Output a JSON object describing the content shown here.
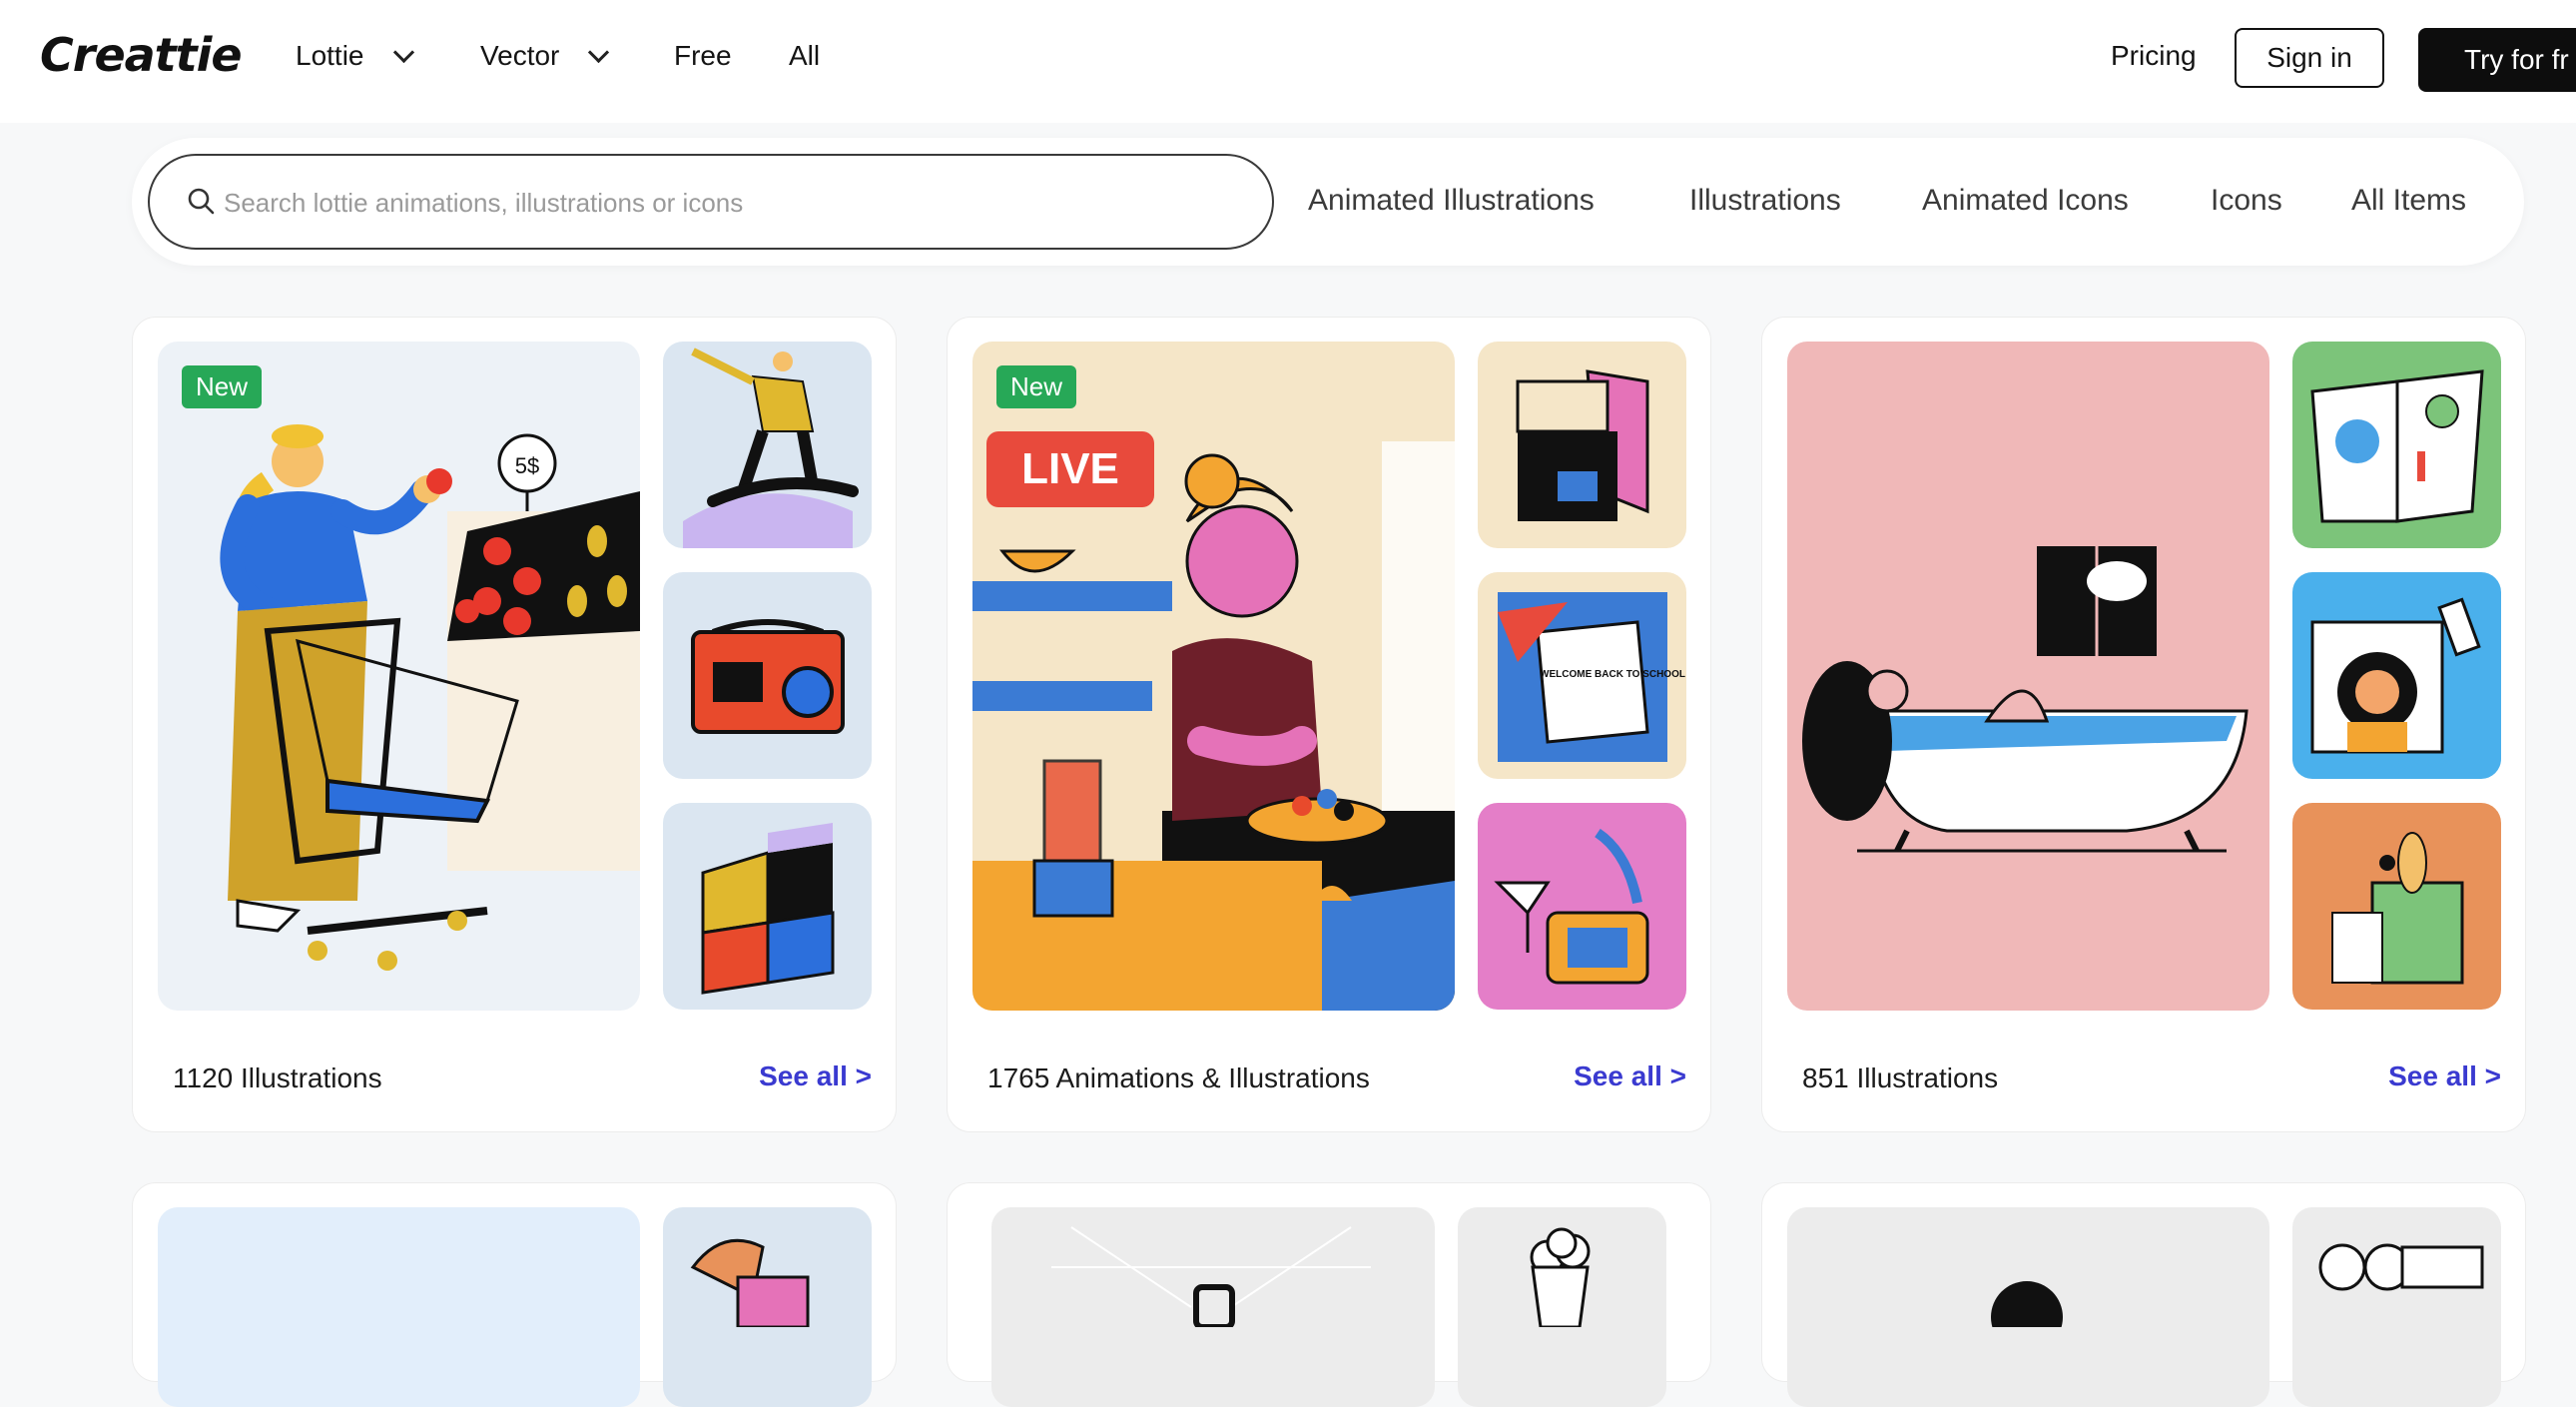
{
  "header": {
    "logo": "Creattie",
    "nav": [
      {
        "label": "Lottie",
        "has_dropdown": true
      },
      {
        "label": "Vector",
        "has_dropdown": true
      },
      {
        "label": "Free",
        "has_dropdown": false
      },
      {
        "label": "All",
        "has_dropdown": false
      }
    ],
    "pricing": "Pricing",
    "sign_in": "Sign in",
    "try_free": "Try for fr"
  },
  "search": {
    "placeholder": "Search lottie animations, illustrations or icons",
    "value": ""
  },
  "categories": [
    "Animated Illustrations",
    "Illustrations",
    "Animated Icons",
    "Icons",
    "All Items"
  ],
  "collections": [
    {
      "badge": "New",
      "count_label": "1120 Illustrations",
      "see_all": "See all >"
    },
    {
      "badge": "New",
      "count_label": "1765 Animations & Illustrations",
      "see_all": "See all >",
      "live_label": "LIVE",
      "welcome_text": "WELCOME BACK TO SCHOOL"
    },
    {
      "badge": "",
      "count_label": "851 Illustrations",
      "see_all": "See all >"
    }
  ],
  "price_tag": "5$",
  "colors": {
    "accent_link": "#3a3ad0",
    "badge_green": "#27a857",
    "primary_button": "#0d0d0d"
  }
}
